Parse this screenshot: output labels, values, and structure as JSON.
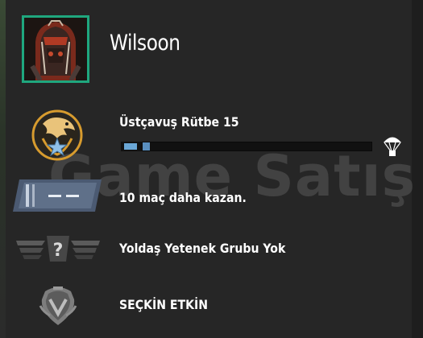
{
  "profile": {
    "username": "Wilsoon",
    "avatar": "armored-warrior-avatar"
  },
  "rank": {
    "title": "Üstçavuş Rütbe 15",
    "icon": "eagle-star-rank-icon",
    "xp_progress": 0.03,
    "drop_icon": "parachute-icon"
  },
  "competitive": {
    "text": "10 maç daha kazan.",
    "icon": "unranked-badge-icon"
  },
  "wingman": {
    "text": "Yoldaş Yetenek Grubu Yok",
    "icon": "unknown-wingman-rank-icon"
  },
  "badge": {
    "text": "SEÇKİN ETKİN",
    "icon": "prime-badge-icon"
  },
  "watermark": {
    "text": "Game Satış"
  },
  "colors": {
    "accent": "#1fa77e",
    "xp": "#6aa7d6",
    "background": "#262626"
  }
}
